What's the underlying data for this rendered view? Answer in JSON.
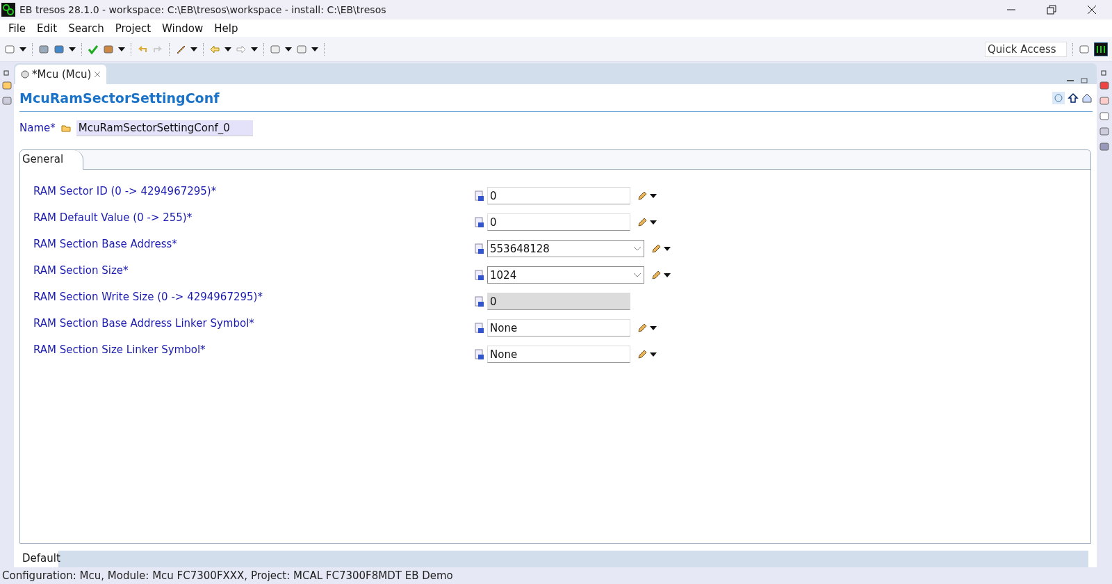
{
  "window": {
    "title": "EB tresos 28.1.0 - workspace: C:\\EB\\tresos\\workspace - install: C:\\EB\\tresos"
  },
  "menu": [
    "File",
    "Edit",
    "Search",
    "Project",
    "Window",
    "Help"
  ],
  "quick_access": {
    "placeholder": "Quick Access"
  },
  "editor_tab": {
    "label": "*Mcu (Mcu)",
    "selected": true
  },
  "header": {
    "title": "McuRamSectorSettingConf"
  },
  "name_field": {
    "label": "Name*",
    "value": "McuRamSectorSettingConf_0"
  },
  "section_tabs": [
    {
      "label": "General",
      "selected": true
    }
  ],
  "fields": [
    {
      "label": "RAM Sector ID (0 -> 4294967295)*",
      "value": "0",
      "kind": "text",
      "disabled": false
    },
    {
      "label": "RAM Default Value (0 -> 255)*",
      "value": "0",
      "kind": "text",
      "disabled": false
    },
    {
      "label": "RAM Section Base Address*",
      "value": "553648128",
      "kind": "combo",
      "disabled": false
    },
    {
      "label": "RAM Section Size*",
      "value": "1024",
      "kind": "combo",
      "disabled": false
    },
    {
      "label": "RAM Section Write Size (0 -> 4294967295)*",
      "value": "0",
      "kind": "text",
      "disabled": true
    },
    {
      "label": "RAM Section Base Address Linker Symbol*",
      "value": "None",
      "kind": "text",
      "disabled": false
    },
    {
      "label": "RAM Section Size Linker Symbol*",
      "value": "None",
      "kind": "text",
      "disabled": false
    }
  ],
  "bottom_tabs": [
    {
      "label": "Default",
      "selected": true
    }
  ],
  "status_bar": "Configuration: Mcu, Module: Mcu FC7300FXXX, Project: MCAL FC7300F8MDT EB Demo"
}
